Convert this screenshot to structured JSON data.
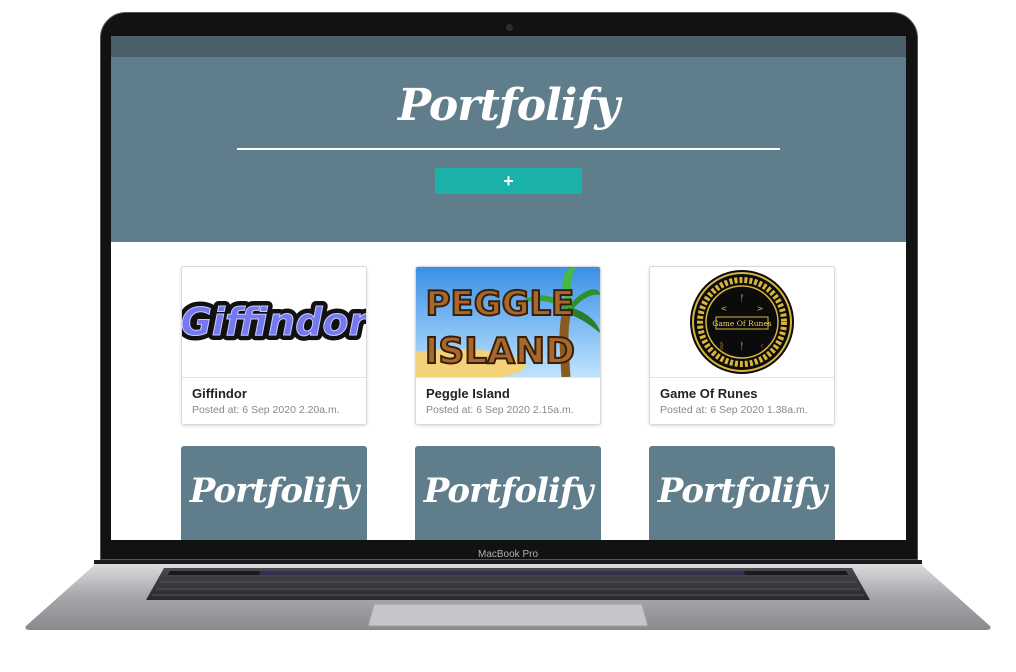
{
  "device": {
    "label": "MacBook Pro"
  },
  "app": {
    "brand": "Portfolify",
    "add_button_label": "+"
  },
  "projects": [
    {
      "title": "Giffindor",
      "posted": "Posted at: 6 Sep 2020 2.20a.m.",
      "thumb_text": "Giffindor"
    },
    {
      "title": "Peggle Island",
      "posted": "Posted at: 6 Sep 2020 2.15a.m.",
      "thumb_line1": "PEGGLE",
      "thumb_line2": "ISLAND"
    },
    {
      "title": "Game Of Runes",
      "posted": "Posted at: 6 Sep 2020 1.38a.m.",
      "thumb_text": "Game Of Runes"
    }
  ],
  "placeholders": [
    {
      "logo": "Portfolify"
    },
    {
      "logo": "Portfolify"
    },
    {
      "logo": "Portfolify"
    }
  ],
  "colors": {
    "header": "#607d8b",
    "accent": "#1ab2a8"
  }
}
